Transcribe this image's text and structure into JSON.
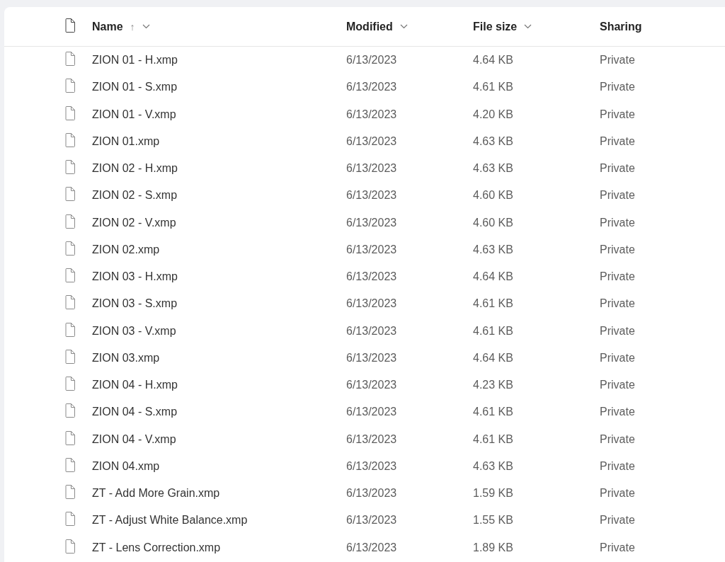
{
  "columns": [
    {
      "kind": "icon"
    },
    {
      "kind": "text",
      "label": "Name",
      "sort_arrow": "↑",
      "menu": true
    },
    {
      "kind": "text",
      "label": "Modified",
      "menu": true
    },
    {
      "kind": "text",
      "label": "File size",
      "menu": true
    },
    {
      "kind": "text",
      "label": "Sharing",
      "menu": false
    }
  ],
  "rows": [
    {
      "name": "ZION 01 - H.xmp",
      "modified": "6/13/2023",
      "size": "4.64 KB",
      "sharing": "Private"
    },
    {
      "name": "ZION 01 - S.xmp",
      "modified": "6/13/2023",
      "size": "4.61 KB",
      "sharing": "Private"
    },
    {
      "name": "ZION 01 - V.xmp",
      "modified": "6/13/2023",
      "size": "4.20 KB",
      "sharing": "Private"
    },
    {
      "name": "ZION 01.xmp",
      "modified": "6/13/2023",
      "size": "4.63 KB",
      "sharing": "Private"
    },
    {
      "name": "ZION 02 - H.xmp",
      "modified": "6/13/2023",
      "size": "4.63 KB",
      "sharing": "Private"
    },
    {
      "name": "ZION 02 - S.xmp",
      "modified": "6/13/2023",
      "size": "4.60 KB",
      "sharing": "Private"
    },
    {
      "name": "ZION 02 - V.xmp",
      "modified": "6/13/2023",
      "size": "4.60 KB",
      "sharing": "Private"
    },
    {
      "name": "ZION 02.xmp",
      "modified": "6/13/2023",
      "size": "4.63 KB",
      "sharing": "Private"
    },
    {
      "name": "ZION 03 - H.xmp",
      "modified": "6/13/2023",
      "size": "4.64 KB",
      "sharing": "Private"
    },
    {
      "name": "ZION 03 - S.xmp",
      "modified": "6/13/2023",
      "size": "4.61 KB",
      "sharing": "Private"
    },
    {
      "name": "ZION 03 - V.xmp",
      "modified": "6/13/2023",
      "size": "4.61 KB",
      "sharing": "Private"
    },
    {
      "name": "ZION 03.xmp",
      "modified": "6/13/2023",
      "size": "4.64 KB",
      "sharing": "Private"
    },
    {
      "name": "ZION 04 - H.xmp",
      "modified": "6/13/2023",
      "size": "4.23 KB",
      "sharing": "Private"
    },
    {
      "name": "ZION 04 - S.xmp",
      "modified": "6/13/2023",
      "size": "4.61 KB",
      "sharing": "Private"
    },
    {
      "name": "ZION 04 - V.xmp",
      "modified": "6/13/2023",
      "size": "4.61 KB",
      "sharing": "Private"
    },
    {
      "name": "ZION 04.xmp",
      "modified": "6/13/2023",
      "size": "4.63 KB",
      "sharing": "Private"
    },
    {
      "name": "ZT - Add More Grain.xmp",
      "modified": "6/13/2023",
      "size": "1.59 KB",
      "sharing": "Private"
    },
    {
      "name": "ZT - Adjust White Balance.xmp",
      "modified": "6/13/2023",
      "size": "1.55 KB",
      "sharing": "Private"
    },
    {
      "name": "ZT - Lens Correction.xmp",
      "modified": "6/13/2023",
      "size": "1.89 KB",
      "sharing": "Private"
    }
  ]
}
